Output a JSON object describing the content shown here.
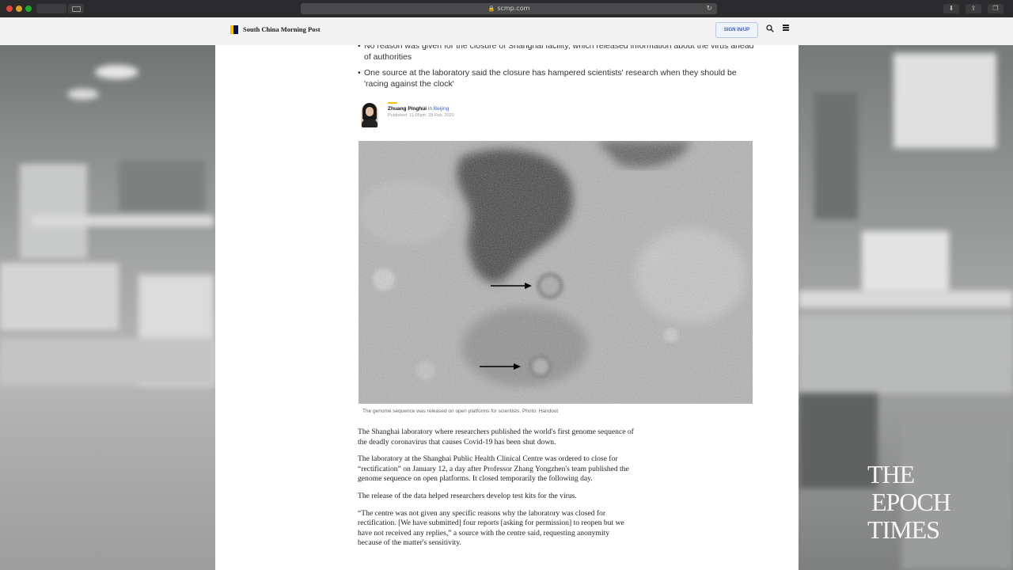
{
  "browser": {
    "url": "scmp.com"
  },
  "site": {
    "name": "South China Morning Post",
    "signin_label": "SIGN IN/UP"
  },
  "article": {
    "bullets": [
      "No reason was given for the closure of Shanghai facility, which released information about the virus ahead of authorities",
      "One source at the laboratory said the closure has hampered scientists' research when they should be 'racing against the clock'"
    ],
    "author_name": "Zhuang Pinghui",
    "author_location": "in Beijing",
    "published": "Published: 11:05pm, 28 Feb, 2020",
    "image_caption": "The genome sequence was released on open platforms for scientists. Photo: Handout",
    "paragraphs": [
      "The Shanghai laboratory where researchers published the world's first genome sequence of the deadly coronavirus that causes Covid-19 has been shut down.",
      "The laboratory at the Shanghai Public Health Clinical Centre was ordered to close for “rectification” on January 12, a day after Professor Zhang Yongzhen's team published the genome sequence on open platforms. It closed temporarily the following day.",
      "The release of the data helped researchers develop test kits for the virus.",
      "“The centre was not given any specific reasons why the laboratory was closed for rectification. [We have submitted] four reports [asking for permission] to reopen but we have not received any replies,” a source with the centre said, requesting anonymity because of the matter's sensitivity."
    ]
  },
  "watermark": {
    "line1": "THE",
    "line2": "EPOCH",
    "line3": "TIMES"
  },
  "colors": {
    "scmp_yellow": "#ffc200",
    "scmp_navy": "#001246",
    "link_blue": "#3a5db8"
  }
}
